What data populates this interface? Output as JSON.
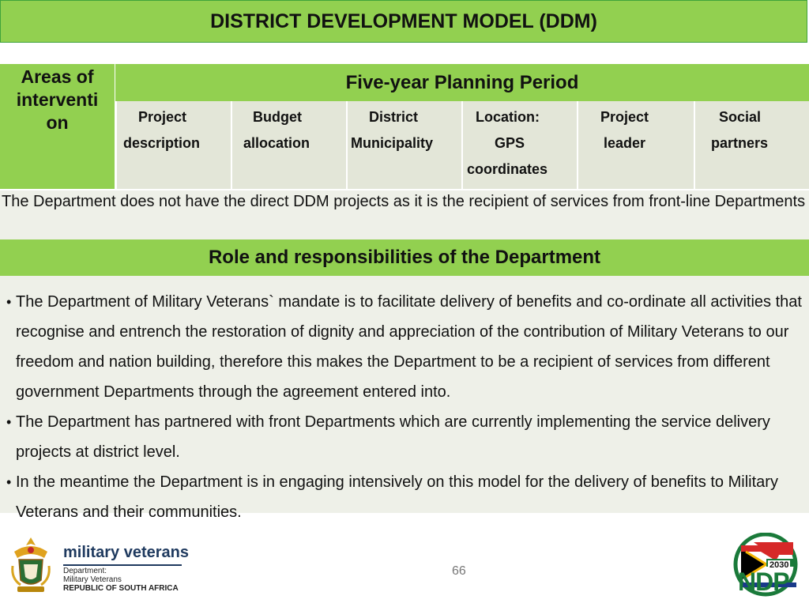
{
  "header": {
    "title": "DISTRICT DEVELOPMENT MODEL (DDM)"
  },
  "table": {
    "areas_label": "Areas of interventi on",
    "areas_lines": [
      "Areas of",
      "interventi",
      "on"
    ],
    "period_label": "Five-year Planning Period",
    "columns": [
      {
        "lines": [
          "Project",
          "description"
        ]
      },
      {
        "lines": [
          "Budget",
          "allocation"
        ]
      },
      {
        "lines": [
          "District",
          "Municipality"
        ]
      },
      {
        "lines": [
          "Location:",
          "GPS",
          "coordinates"
        ]
      },
      {
        "lines": [
          "Project",
          "leader"
        ]
      },
      {
        "lines": [
          "Social",
          "partners"
        ]
      }
    ],
    "note": " The Department does not have the direct DDM projects as it is the recipient of services from front-line Departments"
  },
  "role": {
    "heading": "Role and responsibilities of the Department",
    "bullet_glyph": "•",
    "bullets": [
      "The Department of Military Veterans` mandate is to facilitate delivery of benefits and co-ordinate all activities that recognise and entrench the restoration of dignity and appreciation of the contribution of Military Veterans to our freedom and nation building, therefore this makes the Department to be a recipient of services from different government Departments through the agreement entered into.",
      "The Department has partnered with front Departments which are currently implementing the service delivery projects at district level.",
      "In the meantime the Department is in engaging intensively on this model for the delivery of benefits to Military Veterans and their communities."
    ]
  },
  "footer": {
    "brand": "military veterans",
    "dept_line1": "Department:",
    "dept_line2": "Military Veterans",
    "dept_line3": "REPUBLIC OF SOUTH AFRICA",
    "page_number": "66",
    "ndp_year": "2030",
    "ndp_text": "NDP"
  },
  "colors": {
    "accent_green": "#92d050",
    "cell_bg": "#e3e6d8",
    "row_bg": "#eef0e8"
  }
}
